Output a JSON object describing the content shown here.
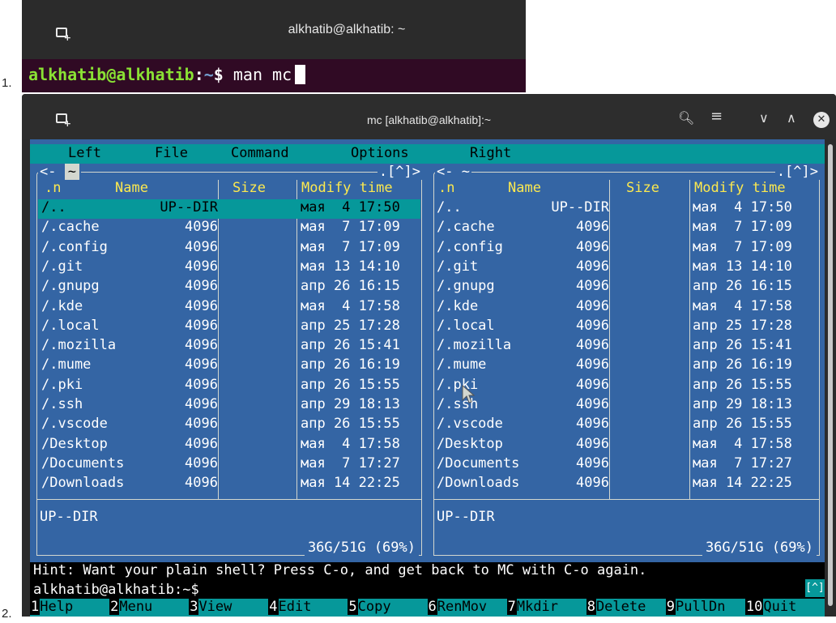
{
  "steps": [
    "1.",
    "2."
  ],
  "window1": {
    "title": "alkhatib@alkhatib: ~",
    "prompt_user": "alkhatib@alkhatib",
    "prompt_sep": ":",
    "prompt_path": "~",
    "prompt_symbol": "$",
    "command": " man mc"
  },
  "window2": {
    "title": "mc [alkhatib@alkhatib]:~",
    "menu": [
      "Left",
      "File",
      "Command",
      "Options",
      "Right"
    ],
    "left_panel": {
      "path_prefix": "<-",
      "path": "~",
      "history": ".[^]>",
      "headers": {
        "n": ".n",
        "name": "Name",
        "size": "Size",
        "time": "Modify time"
      },
      "status": "UP--DIR",
      "free": "36G/51G (69%)"
    },
    "right_panel": {
      "path_prefix": "<-",
      "path": "~",
      "history": ".[^]>",
      "headers": {
        "n": ".n",
        "name": "Name",
        "size": "Size",
        "time": "Modify time"
      },
      "status": "UP--DIR",
      "free": "36G/51G (69%)"
    },
    "files": [
      {
        "name": "/..",
        "size": "UP--DIR",
        "time": "мая  4 17:50"
      },
      {
        "name": "/.cache",
        "size": "4096",
        "time": "мая  7 17:09"
      },
      {
        "name": "/.config",
        "size": "4096",
        "time": "мая  7 17:09"
      },
      {
        "name": "/.git",
        "size": "4096",
        "time": "мая 13 14:10"
      },
      {
        "name": "/.gnupg",
        "size": "4096",
        "time": "апр 26 16:15"
      },
      {
        "name": "/.kde",
        "size": "4096",
        "time": "мая  4 17:58"
      },
      {
        "name": "/.local",
        "size": "4096",
        "time": "апр 25 17:28"
      },
      {
        "name": "/.mozilla",
        "size": "4096",
        "time": "апр 26 15:41"
      },
      {
        "name": "/.mume",
        "size": "4096",
        "time": "апр 26 16:19"
      },
      {
        "name": "/.pki",
        "size": "4096",
        "time": "апр 26 15:55"
      },
      {
        "name": "/.ssh",
        "size": "4096",
        "time": "апр 29 18:13"
      },
      {
        "name": "/.vscode",
        "size": "4096",
        "time": "апр 26 15:55"
      },
      {
        "name": "/Desktop",
        "size": "4096",
        "time": "мая  4 17:58"
      },
      {
        "name": "/Documents",
        "size": "4096",
        "time": "мая  7 17:27"
      },
      {
        "name": "/Downloads",
        "size": "4096",
        "time": "мая 14 22:25"
      }
    ],
    "hint": "Hint: Want your plain shell? Press C-o, and get back to MC with C-o again.",
    "shell_prompt": "alkhatib@alkhatib:~$",
    "shell_badge": "[^]",
    "fkeys": [
      {
        "num": "1",
        "label": "Help"
      },
      {
        "num": "2",
        "label": "Menu"
      },
      {
        "num": "3",
        "label": "View"
      },
      {
        "num": "4",
        "label": "Edit"
      },
      {
        "num": "5",
        "label": "Copy"
      },
      {
        "num": "6",
        "label": "RenMov"
      },
      {
        "num": "7",
        "label": "Mkdir"
      },
      {
        "num": "8",
        "label": "Delete"
      },
      {
        "num": "9",
        "label": "PullDn"
      },
      {
        "num": "10",
        "label": "Quit"
      }
    ]
  },
  "colors": {
    "panel_bg": "#3465a4",
    "cyan": "#06989a",
    "header_yellow": "#fce94f",
    "prompt_green": "#8ae234",
    "prompt_blue": "#729fcf"
  },
  "icons": [
    "new-tab-icon",
    "search-icon",
    "hamburger-menu-icon",
    "minimize-icon",
    "maximize-icon",
    "close-icon",
    "mouse-pointer-icon"
  ]
}
